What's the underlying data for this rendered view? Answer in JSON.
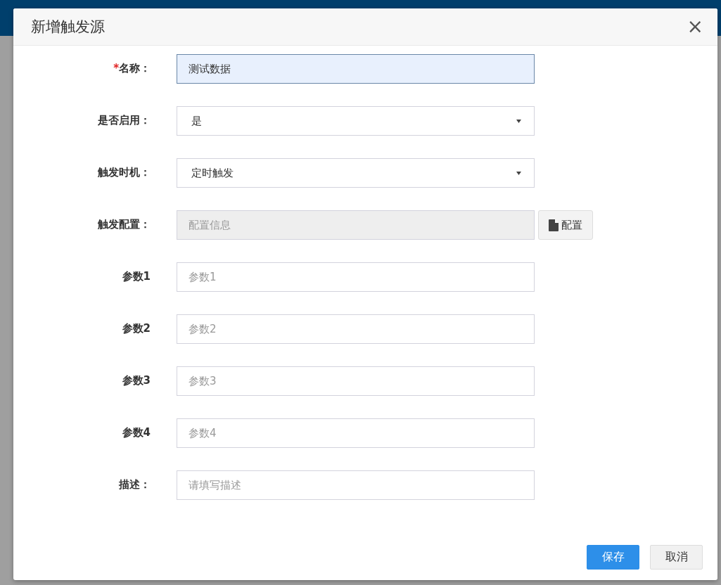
{
  "dialog": {
    "title": "新增触发源",
    "close": "×"
  },
  "fields": [
    {
      "kind": "text",
      "required_mark": "*",
      "label": "名称：",
      "value": "测试数据",
      "focused": true
    },
    {
      "kind": "select",
      "label": "是否启用：",
      "value": "是"
    },
    {
      "kind": "select",
      "label": "触发时机：",
      "value": "定时触发"
    },
    {
      "kind": "config",
      "label": "触发配置：",
      "placeholder": "配置信息",
      "disabled": true,
      "button": "配置"
    },
    {
      "kind": "text",
      "label": "参数1",
      "placeholder": "参数1"
    },
    {
      "kind": "text",
      "label": "参数2",
      "placeholder": "参数2"
    },
    {
      "kind": "text",
      "label": "参数3",
      "placeholder": "参数3"
    },
    {
      "kind": "text",
      "label": "参数4",
      "placeholder": "参数4"
    },
    {
      "kind": "text",
      "label": "描述：",
      "placeholder": "请填写描述"
    }
  ],
  "buttons": [
    {
      "label": "保存",
      "primary": true
    },
    {
      "label": "取消",
      "primary": false
    }
  ]
}
